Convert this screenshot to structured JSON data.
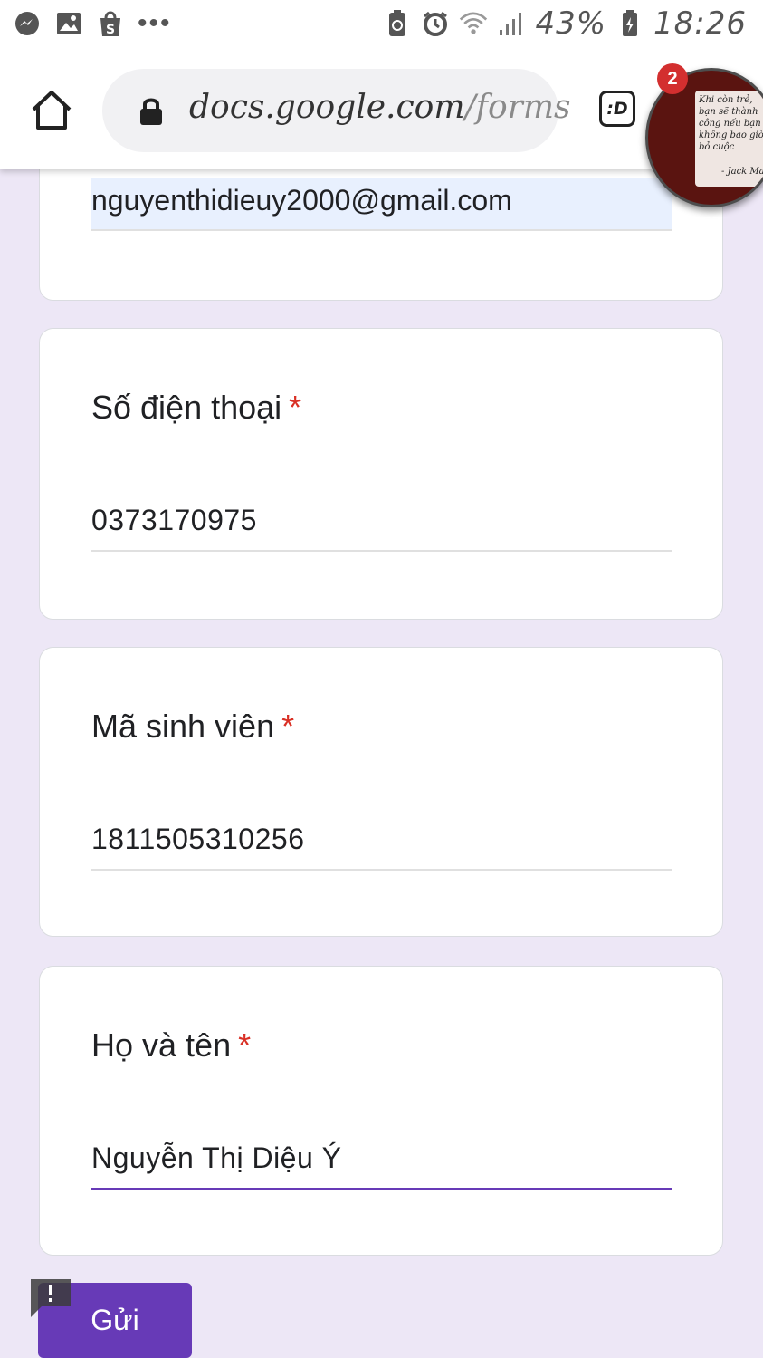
{
  "status_bar": {
    "battery": "43%",
    "time": "18:26",
    "icons": [
      "messenger-icon",
      "gallery-icon",
      "shopee-icon",
      "more-dots",
      "battery-saver-icon",
      "alarm-icon",
      "wifi-icon",
      "signal-icon",
      "battery-icon"
    ]
  },
  "browser": {
    "url_domain": "docs.google.com",
    "url_path": "/forms",
    "tab_button": ":D",
    "bubble_badge": "2",
    "bubble_quote": "Khi còn trẻ, bạn sẽ thành công nếu bạn không bao giờ bỏ cuộc",
    "bubble_author": "- Jack Ma-"
  },
  "form": {
    "email_value": "nguyenthidieuy2000@gmail.com",
    "questions": [
      {
        "title": "Số điện thoại",
        "required_mark": "*",
        "value": "0373170975"
      },
      {
        "title": "Mã sinh viên",
        "required_mark": "*",
        "value": "1811505310256"
      },
      {
        "title": "Họ và tên",
        "required_mark": "*",
        "value": "Nguyễn Thị Diệu Ý"
      }
    ],
    "submit_label": "Gửi",
    "accent_color": "#673ab7",
    "required_color": "#d93025"
  }
}
